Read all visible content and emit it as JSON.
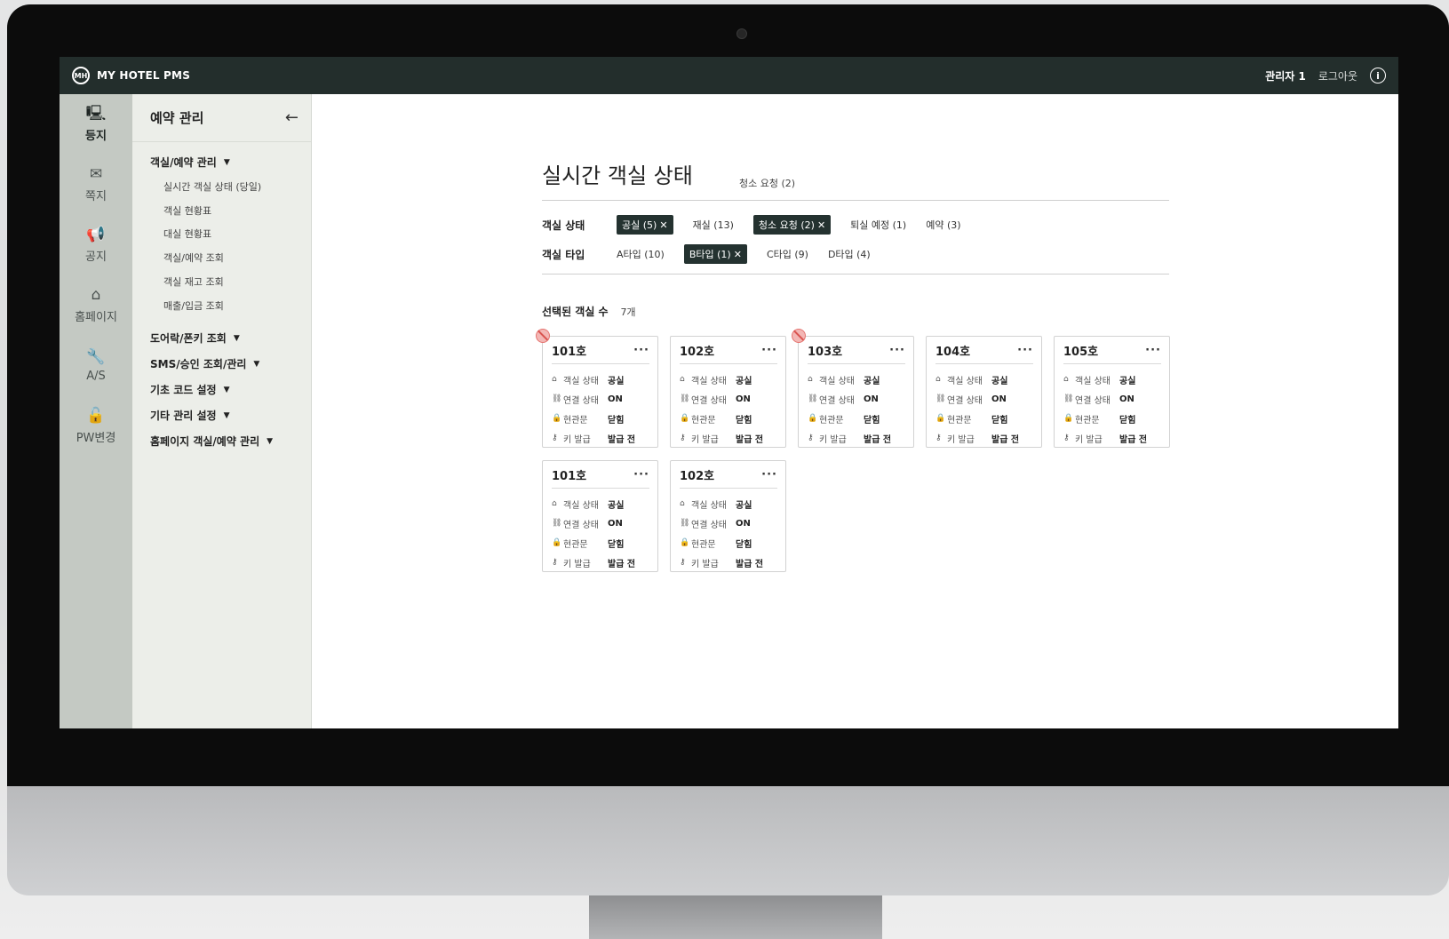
{
  "app": {
    "title": "MY HOTEL PMS",
    "logo_text": "MH"
  },
  "header": {
    "admin": "관리자 1",
    "logout": "로그아웃",
    "info_glyph": "i"
  },
  "rail": [
    {
      "label": "등지",
      "icon": "monitor-icon",
      "glyph": "🖳"
    },
    {
      "label": "쪽지",
      "icon": "message-icon",
      "glyph": "✉"
    },
    {
      "label": "공지",
      "icon": "megaphone-icon",
      "glyph": "📢"
    },
    {
      "label": "홈페이지",
      "icon": "home-icon",
      "glyph": "⌂"
    },
    {
      "label": "A/S",
      "icon": "wrench-icon",
      "glyph": "🔧"
    },
    {
      "label": "PW변경",
      "icon": "lock-icon",
      "glyph": "🔓"
    }
  ],
  "menu": {
    "title": "예약 관리",
    "back_glyph": "←",
    "group1": {
      "label": "객실/예약 관리",
      "caret": "▼"
    },
    "sub": [
      "실시간 객실 상태 (당일)",
      "객실 현황표",
      "대실 현황표",
      "객실/예약 조회",
      "객실 재고 조회",
      "매출/입금 조회"
    ],
    "groups": [
      {
        "label": "도어락/폰키 조회",
        "caret": "▼"
      },
      {
        "label": "SMS/승인 조회/관리",
        "caret": "▼"
      },
      {
        "label": "기초 코드 설정",
        "caret": "▼"
      },
      {
        "label": "기타 관리 설정",
        "caret": "▼"
      },
      {
        "label": "홈페이지 객실/예약 관리",
        "caret": "▼"
      }
    ]
  },
  "main": {
    "title": "실시간 객실 상태",
    "subtitle": "청소 요청 (2)",
    "status_filter": {
      "label": "객실 상태",
      "chips": [
        {
          "text": "공실 (5)",
          "active": true
        },
        {
          "text": "재실 (13)",
          "active": false
        },
        {
          "text": "청소 요청 (2)",
          "active": true
        },
        {
          "text": "퇴실 예정 (1)",
          "active": false
        },
        {
          "text": "예약 (3)",
          "active": false
        }
      ]
    },
    "type_filter": {
      "label": "객실 타입",
      "chips": [
        {
          "text": "A타입 (10)",
          "active": false
        },
        {
          "text": "B타입 (1)",
          "active": true
        },
        {
          "text": "C타입 (9)",
          "active": false
        },
        {
          "text": "D타입 (4)",
          "active": false
        }
      ]
    },
    "close_glyph": "✕",
    "count": {
      "label": "선택된 객실 수",
      "value": "7개"
    },
    "more_glyph": "···",
    "rooms": [
      {
        "no": "101호",
        "flag": true
      },
      {
        "no": "102호",
        "flag": false
      },
      {
        "no": "103호",
        "flag": true
      },
      {
        "no": "104호",
        "flag": false
      },
      {
        "no": "105호",
        "flag": false
      },
      {
        "no": "101호",
        "flag": false
      },
      {
        "no": "102호",
        "flag": false
      }
    ],
    "room_fields": [
      {
        "icon": "house-icon",
        "glyph": "⌂",
        "key": "객실 상태",
        "value": "공실"
      },
      {
        "icon": "link-icon",
        "glyph": "⛓",
        "key": "연결 상태",
        "value": "ON"
      },
      {
        "icon": "lock-icon",
        "glyph": "🔒",
        "key": "현관문",
        "value": "닫힘"
      },
      {
        "icon": "key-icon",
        "glyph": "⚷",
        "key": "키 발급",
        "value": "발급 전"
      }
    ]
  }
}
